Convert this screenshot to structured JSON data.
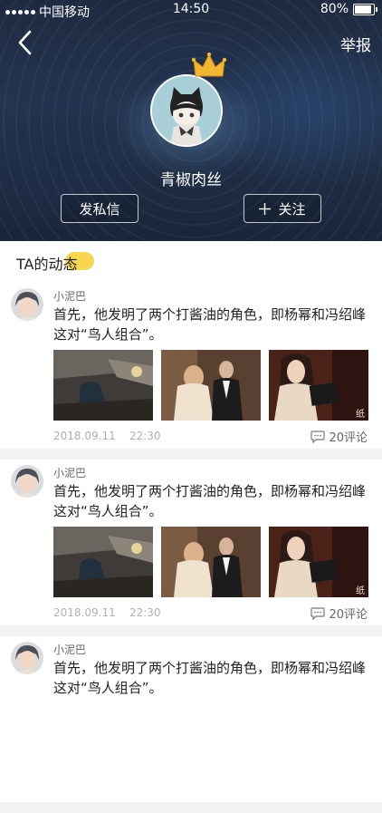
{
  "status_bar": {
    "carrier": "中国移动",
    "time": "14:50",
    "battery": "80%",
    "battery_level": 0.8
  },
  "header": {
    "report_label": "举报",
    "nickname": "青椒肉丝",
    "message_button": "发私信",
    "follow_button": "关注"
  },
  "section": {
    "title": "TA的动态"
  },
  "posts": [
    {
      "author": "小泥巴",
      "content": "首先，他发明了两个打酱油的角色，即杨幂和冯绍峰这对“鸟人组合”。",
      "date": "2018.09.11",
      "time": "22:30",
      "comments": "20评论"
    },
    {
      "author": "小泥巴",
      "content": "首先，他发明了两个打酱油的角色，即杨幂和冯绍峰这对“鸟人组合”。",
      "date": "2018.09.11",
      "time": "22:30",
      "comments": "20评论"
    },
    {
      "author": "小泥巴",
      "content": "首先，他发明了两个打酱油的角色，即杨幂和冯绍峰这对“鸟人组合”。"
    }
  ],
  "colors": {
    "accent": "#f7d13c",
    "header_bg": "#243552"
  }
}
